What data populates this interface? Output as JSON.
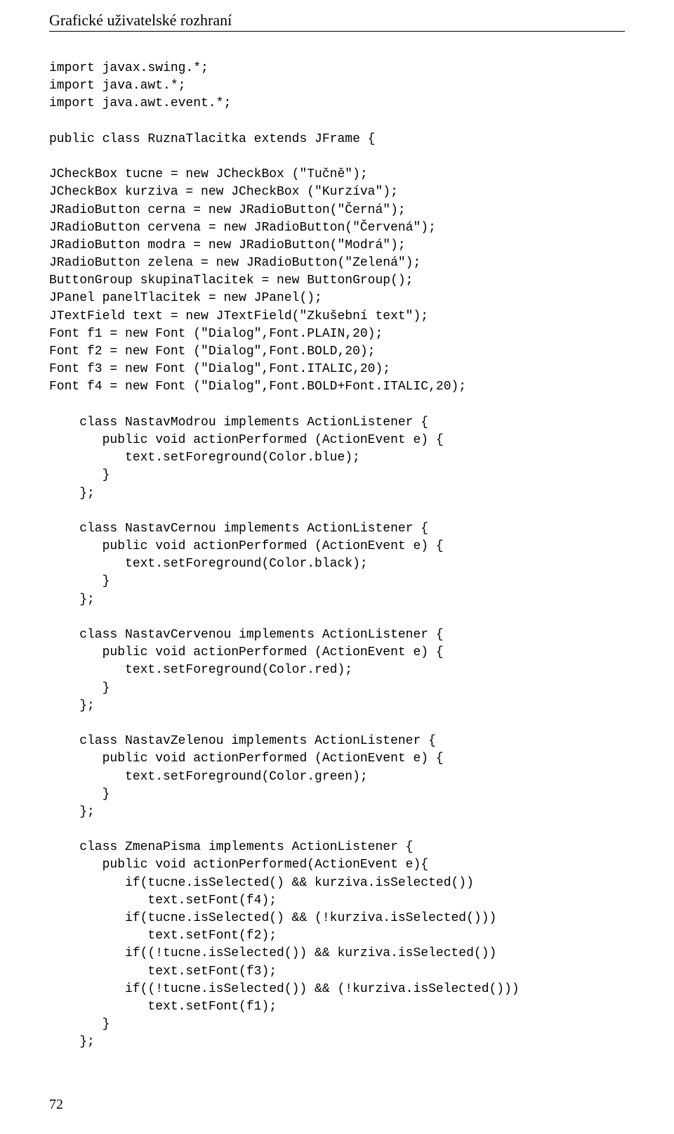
{
  "header": "Grafické uživatelské rozhraní",
  "page_number": "72",
  "code_lines": [
    "import javax.swing.*;",
    "import java.awt.*;",
    "import java.awt.event.*;",
    "",
    "public class RuznaTlacitka extends JFrame {",
    "",
    "JCheckBox tucne = new JCheckBox (\"Tučně\");",
    "JCheckBox kurziva = new JCheckBox (\"Kurzíva\");",
    "JRadioButton cerna = new JRadioButton(\"Černá\");",
    "JRadioButton cervena = new JRadioButton(\"Červená\");",
    "JRadioButton modra = new JRadioButton(\"Modrá\");",
    "JRadioButton zelena = new JRadioButton(\"Zelená\");",
    "ButtonGroup skupinaTlacitek = new ButtonGroup();",
    "JPanel panelTlacitek = new JPanel();",
    "JTextField text = new JTextField(\"Zkušební text\");",
    "Font f1 = new Font (\"Dialog\",Font.PLAIN,20);",
    "Font f2 = new Font (\"Dialog\",Font.BOLD,20);",
    "Font f3 = new Font (\"Dialog\",Font.ITALIC,20);",
    "Font f4 = new Font (\"Dialog\",Font.BOLD+Font.ITALIC,20);",
    "",
    "    class NastavModrou implements ActionListener {",
    "       public void actionPerformed (ActionEvent e) {",
    "          text.setForeground(Color.blue);",
    "       }",
    "    };",
    "",
    "    class NastavCernou implements ActionListener {",
    "       public void actionPerformed (ActionEvent e) {",
    "          text.setForeground(Color.black);",
    "       }",
    "    };",
    "",
    "    class NastavCervenou implements ActionListener {",
    "       public void actionPerformed (ActionEvent e) {",
    "          text.setForeground(Color.red);",
    "       }",
    "    };",
    "",
    "    class NastavZelenou implements ActionListener {",
    "       public void actionPerformed (ActionEvent e) {",
    "          text.setForeground(Color.green);",
    "       }",
    "    };",
    "",
    "    class ZmenaPisma implements ActionListener {",
    "       public void actionPerformed(ActionEvent e){",
    "          if(tucne.isSelected() && kurziva.isSelected())",
    "             text.setFont(f4);",
    "          if(tucne.isSelected() && (!kurziva.isSelected()))",
    "             text.setFont(f2);",
    "          if((!tucne.isSelected()) && kurziva.isSelected())",
    "             text.setFont(f3);",
    "          if((!tucne.isSelected()) && (!kurziva.isSelected()))",
    "             text.setFont(f1);",
    "       }",
    "    };"
  ]
}
